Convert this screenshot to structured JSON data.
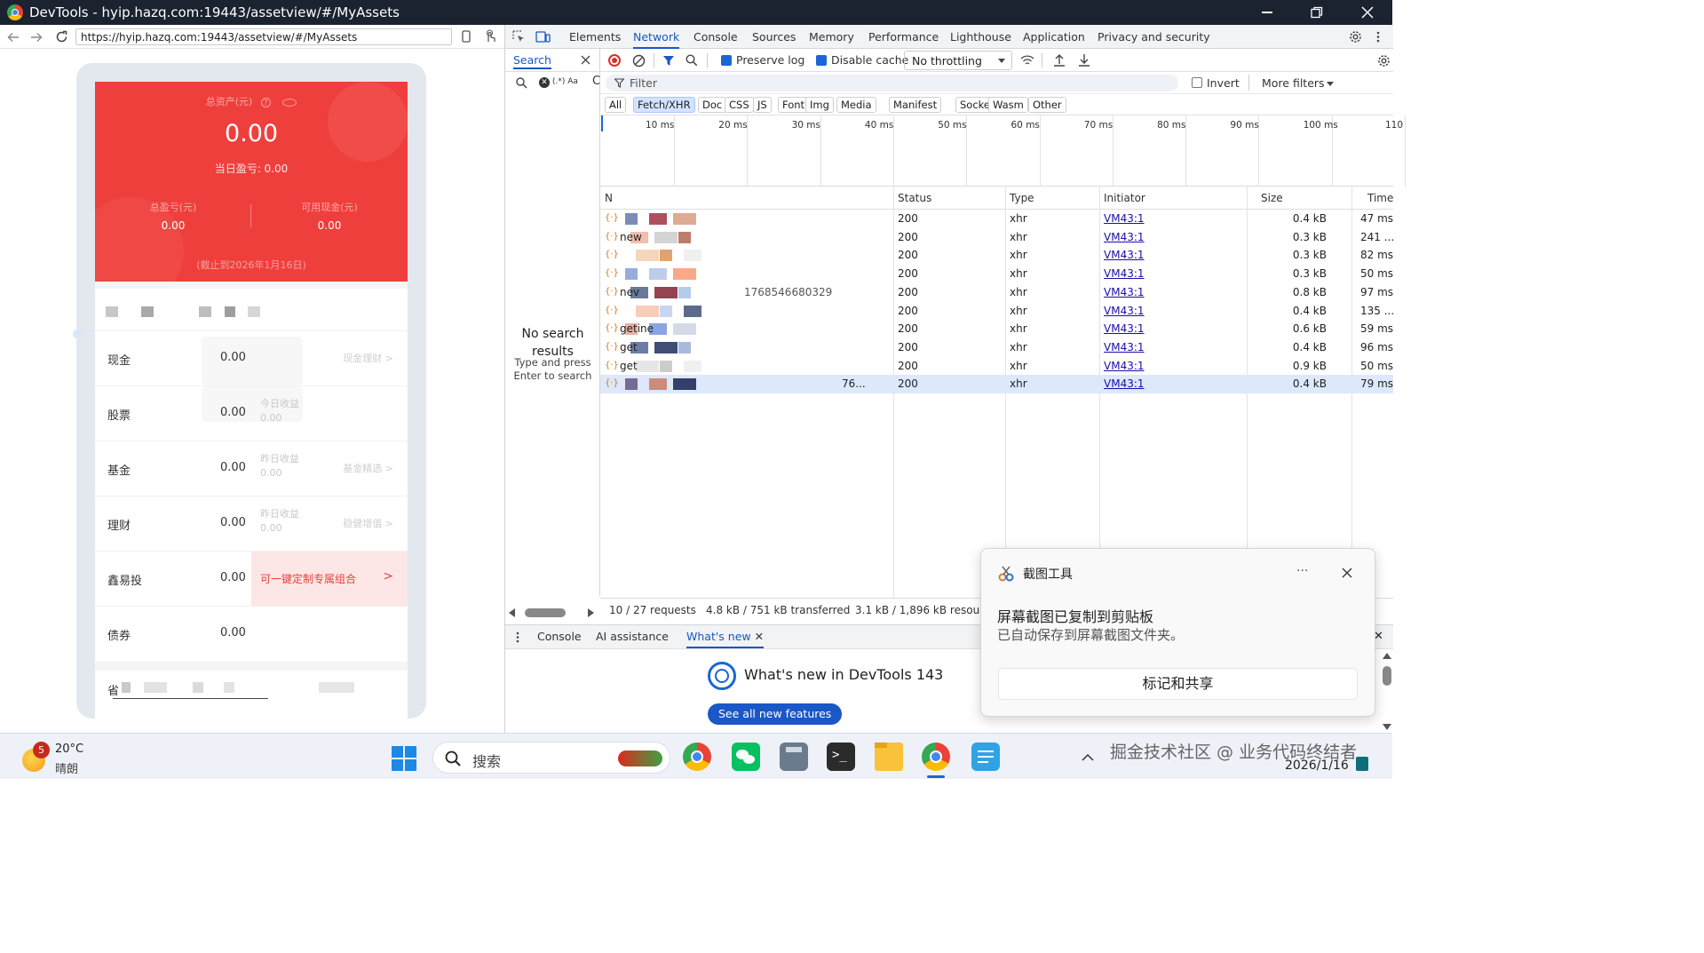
{
  "window": {
    "title": "DevTools - hyip.hazq.com:19443/assetview/#/MyAssets",
    "minimize_icon": "minimize-icon",
    "restore_icon": "restore-icon",
    "close_icon": "close-icon"
  },
  "browser": {
    "url": "https://hyip.hazq.com:19443/assetview/#/MyAssets"
  },
  "app": {
    "total_assets_label": "总资产(元)",
    "total_assets_value": "0.00",
    "daily_pnl": "当日盈亏: 0.00",
    "total_pnl_label": "总盈亏(元)",
    "total_pnl_value": "0.00",
    "cash_available_label": "可用现金(元)",
    "cash_available_value": "0.00",
    "as_of": "(截止到2026年1月16日)",
    "rows": [
      {
        "name": "现金",
        "value": "0.00",
        "sub1": "",
        "sub2": "",
        "link": "现金理财 >"
      },
      {
        "name": "股票",
        "value": "0.00",
        "sub1": "今日收益",
        "sub2": "0.00",
        "link": ""
      },
      {
        "name": "基金",
        "value": "0.00",
        "sub1": "昨日收益",
        "sub2": "0.00",
        "link": "基金精选 >"
      },
      {
        "name": "理财",
        "value": "0.00",
        "sub1": "昨日收益",
        "sub2": "0.00",
        "link": "稳健增值 >"
      },
      {
        "name": "鑫易投",
        "value": "0.00",
        "sub1": "",
        "sub2": "",
        "link": ""
      },
      {
        "name": "债券",
        "value": "0.00",
        "sub1": "",
        "sub2": "",
        "link": ""
      }
    ],
    "promo_text": "可一键定制专属组合",
    "promo_arrow": ">",
    "bottom_char": "省"
  },
  "devtools": {
    "tabs": [
      "Elements",
      "Network",
      "Console",
      "Sources",
      "Memory",
      "Performance",
      "Lighthouse",
      "Application",
      "Privacy and security"
    ],
    "active_tab": "Network",
    "search_tab": "Search",
    "search_options": "(.*) Aa",
    "no_results_title": "No search results",
    "no_results_hint": "Type and press Enter to search",
    "preserve_log": "Preserve log",
    "disable_cache": "Disable cache",
    "throttling": "No throttling",
    "filter_placeholder": "Filter",
    "invert": "Invert",
    "more_filters": "More filters",
    "type_filters": [
      "All",
      "Fetch/XHR",
      "Doc",
      "CSS",
      "JS",
      "Font",
      "Img",
      "Media",
      "Manifest",
      "Socket",
      "Wasm",
      "Other"
    ],
    "active_type": "Fetch/XHR",
    "timeline_ticks": [
      "10 ms",
      "20 ms",
      "30 ms",
      "40 ms",
      "50 ms",
      "60 ms",
      "70 ms",
      "80 ms",
      "90 ms",
      "100 ms",
      "110"
    ],
    "columns": {
      "name": "N",
      "status": "Status",
      "type": "Type",
      "initiator": "Initiator",
      "size": "Size",
      "time": "Time"
    },
    "requests": [
      {
        "name": "",
        "status": "200",
        "type": "xhr",
        "initiator": "VM43:1",
        "size": "0.4 kB",
        "time": "47 ms"
      },
      {
        "name": "new",
        "status": "200",
        "type": "xhr",
        "initiator": "VM43:1",
        "size": "0.3 kB",
        "time": "241 ..."
      },
      {
        "name": "",
        "status": "200",
        "type": "xhr",
        "initiator": "VM43:1",
        "size": "0.3 kB",
        "time": "82 ms"
      },
      {
        "name": "",
        "status": "200",
        "type": "xhr",
        "initiator": "VM43:1",
        "size": "0.3 kB",
        "time": "50 ms"
      },
      {
        "name": "nev",
        "extra": "1768546680329",
        "status": "200",
        "type": "xhr",
        "initiator": "VM43:1",
        "size": "0.8 kB",
        "time": "97 ms"
      },
      {
        "name": "",
        "status": "200",
        "type": "xhr",
        "initiator": "VM43:1",
        "size": "0.4 kB",
        "time": "135 ..."
      },
      {
        "name": "getine",
        "status": "200",
        "type": "xhr",
        "initiator": "VM43:1",
        "size": "0.6 kB",
        "time": "59 ms"
      },
      {
        "name": "get",
        "status": "200",
        "type": "xhr",
        "initiator": "VM43:1",
        "size": "0.4 kB",
        "time": "96 ms"
      },
      {
        "name": "get",
        "status": "200",
        "type": "xhr",
        "initiator": "VM43:1",
        "size": "0.9 kB",
        "time": "50 ms"
      },
      {
        "name": "76...",
        "status": "200",
        "type": "xhr",
        "initiator": "VM43:1",
        "size": "0.4 kB",
        "time": "79 ms"
      }
    ],
    "status_requests": "10 / 27 requests",
    "status_transferred": "4.8 kB / 751 kB transferred",
    "status_resources": "3.1 kB / 1,896 kB resource",
    "drawer_tabs": [
      "Console",
      "AI assistance",
      "What's new"
    ],
    "drawer_active": "What's new",
    "whats_new_title": "What's new in DevTools 143",
    "see_all_button": "See all new features"
  },
  "toast": {
    "app_name": "截图工具",
    "more": "···",
    "title": "屏幕截图已复制到剪贴板",
    "body": "已自动保存到屏幕截图文件夹。",
    "button": "标记和共享"
  },
  "taskbar": {
    "weather_temp": "20°C",
    "weather_desc": "晴朗",
    "weather_badge": "5",
    "search_placeholder": "搜索",
    "date": "2026/1/16",
    "watermark": "掘金技术社区 @ 业务代码终结者",
    "colors": {
      "accent": "#1a66d6",
      "red_card": "#ef3f3c"
    }
  }
}
